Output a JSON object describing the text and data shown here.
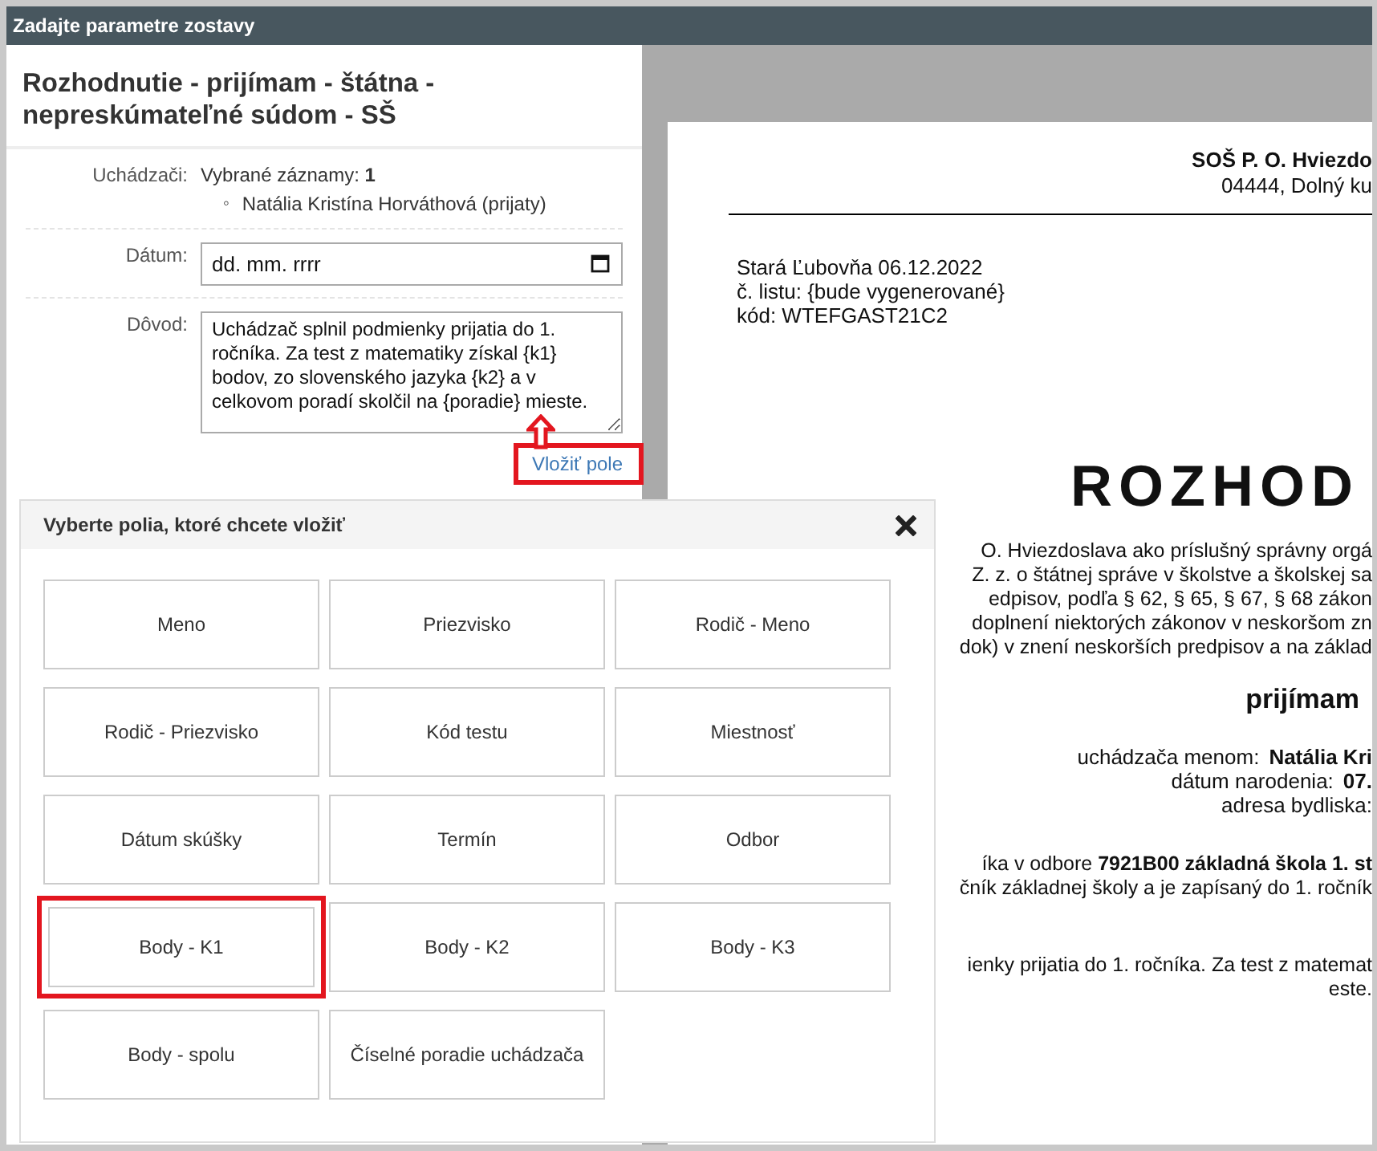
{
  "dialog": {
    "title": "Zadajte parametre zostavy"
  },
  "report_title": "Rozhodnutie - prijímam - štátna - nepreskúmateľné súdom - SŠ",
  "form": {
    "applicants": {
      "label": "Uchádzači:",
      "summary": "Vybrané záznamy: **1**",
      "marker": "◦",
      "items": [
        "Natália Kristína Horváthová (prijaty)"
      ]
    },
    "date": {
      "label": "Dátum:",
      "placeholder": "dd. mm. rrrr"
    },
    "reason": {
      "label": "Dôvod:",
      "value": "Uchádzač splnil podmienky prijatia do 1. ročníka. Za test z matematiky získal {k1} bodov, zo slovenského jazyka {k2} a v celkovom poradí skolčil na {poradie} mieste."
    },
    "insert_link": {
      "label": "Vložiť pole",
      "highlighted": true
    }
  },
  "field_picker": {
    "title": "Vyberte polia, ktoré chcete vložiť",
    "fields": [
      {
        "label": "Meno",
        "highlighted": false
      },
      {
        "label": "Priezvisko",
        "highlighted": false
      },
      {
        "label": "Rodič - Meno",
        "highlighted": false
      },
      {
        "label": "Rodič - Priezvisko",
        "highlighted": false
      },
      {
        "label": "Kód testu",
        "highlighted": false
      },
      {
        "label": "Miestnosť",
        "highlighted": false
      },
      {
        "label": "Dátum skúšky",
        "highlighted": false
      },
      {
        "label": "Termín",
        "highlighted": false
      },
      {
        "label": "Odbor",
        "highlighted": false
      },
      {
        "label": "Body - K1",
        "highlighted": true
      },
      {
        "label": "Body - K2",
        "highlighted": false
      },
      {
        "label": "Body - K3",
        "highlighted": false
      },
      {
        "label": "Body - spolu",
        "highlighted": false
      },
      {
        "label": "Číselné poradie uchádzača",
        "highlighted": false
      }
    ]
  },
  "preview": {
    "org_name": "SOŠ P. O. Hviezdo",
    "org_address": "04444, Dolný ku",
    "place_date": "Stará Ľubovňa  06.12.2022",
    "letter_no": "č. listu: {bude vygenerované}",
    "code": "kód: WTEFGAST21C2",
    "heading": "ROZHOD",
    "intro_lines": [
      "O. Hviezdoslava ako príslušný správny orgá",
      "Z. z. o štátnej správe v školstve a školskej sa",
      "edpisov, podľa § 62, § 65, § 67, § 68 zákon",
      "doplnení niektorých zákonov v neskoršom zn",
      "dok) v znení neskorších predpisov a na základ"
    ],
    "verdict": "prijímam",
    "person": [
      {
        "label": "uchádzača menom:",
        "value": "Natália Kri"
      },
      {
        "label": "dátum narodenia:",
        "value": "07."
      },
      {
        "label": "adresa bydliska:"
      }
    ],
    "field_lines": [
      "íka v odbore **7921B00 základná škola 1. st**",
      "čník základnej školy a je zapísaný do 1. ročník"
    ],
    "reason_lines": [
      "ienky prijatia do 1. ročníka. Za test z matemat",
      "este."
    ]
  }
}
